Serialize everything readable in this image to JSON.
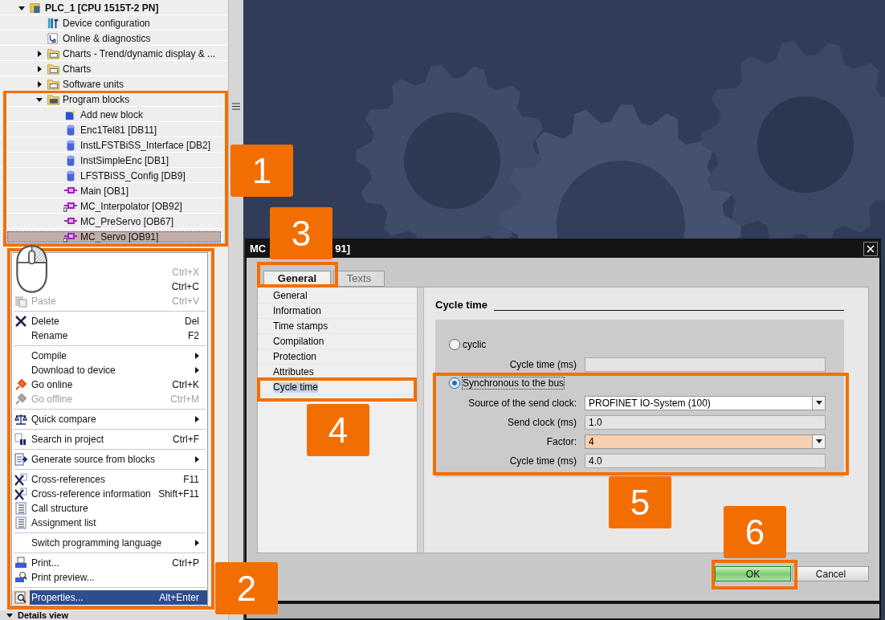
{
  "project_tree": {
    "items": [
      {
        "label": "PLC_1 [CPU 1515T-2 PN]",
        "kind": "plc",
        "expanded": true,
        "selected": false,
        "children": [
          {
            "label": "Device configuration",
            "kind": "device",
            "selected": false
          },
          {
            "label": "Online & diagnostics",
            "kind": "diagnostics",
            "selected": false
          },
          {
            "label": "Charts - Trend/dynamic display & ...",
            "kind": "folder",
            "expanded": false,
            "selected": false
          },
          {
            "label": "Charts",
            "kind": "folder",
            "expanded": false,
            "selected": false
          },
          {
            "label": "Software units",
            "kind": "folder",
            "expanded": false,
            "selected": false
          },
          {
            "label": "Program blocks",
            "kind": "block-folder",
            "expanded": true,
            "selected": false,
            "children": [
              {
                "label": "Add new block",
                "kind": "add",
                "selected": false
              },
              {
                "label": "Enc1Tel81 [DB11]",
                "kind": "db",
                "selected": false
              },
              {
                "label": "InstLFSTBiSS_Interface [DB2]",
                "kind": "db",
                "selected": false
              },
              {
                "label": "InstSimpleEnc [DB1]",
                "kind": "db",
                "selected": false
              },
              {
                "label": "LFSTBiSS_Config [DB9]",
                "kind": "db",
                "selected": false
              },
              {
                "label": "Main [OB1]",
                "kind": "ob",
                "selected": false
              },
              {
                "label": "MC_Interpolator [OB92]",
                "kind": "ob-locked",
                "selected": false
              },
              {
                "label": "MC_PreServo [OB67]",
                "kind": "ob",
                "selected": false
              },
              {
                "label": "MC_Servo [OB91]",
                "kind": "ob-locked",
                "selected": true
              }
            ]
          }
        ]
      }
    ]
  },
  "context_menu": {
    "items": [
      {
        "kind": "plain",
        "shortcut": "Ctrl+X",
        "disabled": true,
        "selected": false
      },
      {
        "kind": "plain",
        "shortcut": "Ctrl+C",
        "disabled": false,
        "selected": false
      },
      {
        "kind": "paste",
        "label": "Paste",
        "shortcut": "Ctrl+V",
        "disabled": true,
        "selected": false
      },
      {
        "kind": "separator"
      },
      {
        "kind": "delete",
        "label": "Delete",
        "shortcut": "Del",
        "disabled": false,
        "selected": false
      },
      {
        "kind": "plain",
        "label": "Rename",
        "shortcut": "F2",
        "disabled": false,
        "selected": false
      },
      {
        "kind": "separator"
      },
      {
        "kind": "plain",
        "label": "Compile",
        "submenu": true,
        "disabled": false,
        "selected": false
      },
      {
        "kind": "plain",
        "label": "Download to device",
        "submenu": true,
        "disabled": false,
        "selected": false
      },
      {
        "kind": "online",
        "label": "Go online",
        "shortcut": "Ctrl+K",
        "disabled": false,
        "selected": false
      },
      {
        "kind": "online",
        "label": "Go offline",
        "shortcut": "Ctrl+M",
        "disabled": true,
        "selected": false
      },
      {
        "kind": "separator"
      },
      {
        "kind": "compare",
        "label": "Quick compare",
        "submenu": true,
        "disabled": false,
        "selected": false
      },
      {
        "kind": "separator"
      },
      {
        "kind": "search",
        "label": "Search in project",
        "shortcut": "Ctrl+F",
        "disabled": false,
        "selected": false
      },
      {
        "kind": "separator"
      },
      {
        "kind": "generate",
        "label": "Generate source from blocks",
        "submenu": true,
        "disabled": false,
        "selected": false
      },
      {
        "kind": "separator"
      },
      {
        "kind": "crossref",
        "label": "Cross-references",
        "shortcut": "F11",
        "disabled": false,
        "selected": false
      },
      {
        "kind": "crossref",
        "label": "Cross-reference information",
        "shortcut": "Shift+F11",
        "disabled": false,
        "selected": false
      },
      {
        "kind": "list",
        "label": "Call structure",
        "disabled": false,
        "selected": false
      },
      {
        "kind": "list",
        "label": "Assignment list",
        "disabled": false,
        "selected": false
      },
      {
        "kind": "separator"
      },
      {
        "kind": "plain",
        "label": "Switch programming language",
        "submenu": true,
        "disabled": false,
        "selected": false
      },
      {
        "kind": "separator"
      },
      {
        "kind": "print",
        "label": "Print...",
        "shortcut": "Ctrl+P",
        "disabled": false,
        "selected": false
      },
      {
        "kind": "preview",
        "label": "Print preview...",
        "disabled": false,
        "selected": false
      },
      {
        "kind": "separator"
      },
      {
        "kind": "properties",
        "label": "Properties...",
        "shortcut": "Alt+Enter",
        "disabled": false,
        "selected": true
      }
    ]
  },
  "details_view": {
    "label": "Details view"
  },
  "dialog": {
    "title_fragments": [
      "MC",
      "91]"
    ],
    "tabs": [
      {
        "label": "General",
        "selected": true
      },
      {
        "label": "Texts",
        "selected": false
      }
    ],
    "nav": [
      {
        "label": "General",
        "selected": false
      },
      {
        "label": "Information",
        "selected": false
      },
      {
        "label": "Time stamps",
        "selected": false
      },
      {
        "label": "Compilation",
        "selected": false
      },
      {
        "label": "Protection",
        "selected": false
      },
      {
        "label": "Attributes",
        "selected": false
      },
      {
        "label": "Cycle time",
        "selected": true
      }
    ],
    "section_title": "Cycle time",
    "options": [
      {
        "label": "cyclic",
        "selected": false,
        "fields": [
          {
            "kind": "readonly",
            "label": "Cycle time (ms)"
          }
        ]
      },
      {
        "label": "Synchronous to the bus",
        "selected": true,
        "fields": [
          {
            "kind": "dropdown",
            "label": "Source of the send clock:",
            "value": "PROFINET IO-System (100)",
            "highlighted": false
          },
          {
            "kind": "readonly",
            "label": "Send clock (ms)",
            "value": "1.0"
          },
          {
            "kind": "dropdown",
            "label": "Factor:",
            "value": "4",
            "highlighted": true
          },
          {
            "kind": "readonly",
            "label": "Cycle time (ms)",
            "value": "4.0"
          }
        ]
      }
    ],
    "buttons": [
      {
        "label": "OK",
        "kind": "primary"
      },
      {
        "label": "Cancel",
        "kind": "secondary"
      }
    ]
  },
  "callouts": [
    {
      "label": "1"
    },
    {
      "label": "2"
    },
    {
      "label": "3"
    },
    {
      "label": "4"
    },
    {
      "label": "5"
    },
    {
      "label": "6"
    }
  ]
}
